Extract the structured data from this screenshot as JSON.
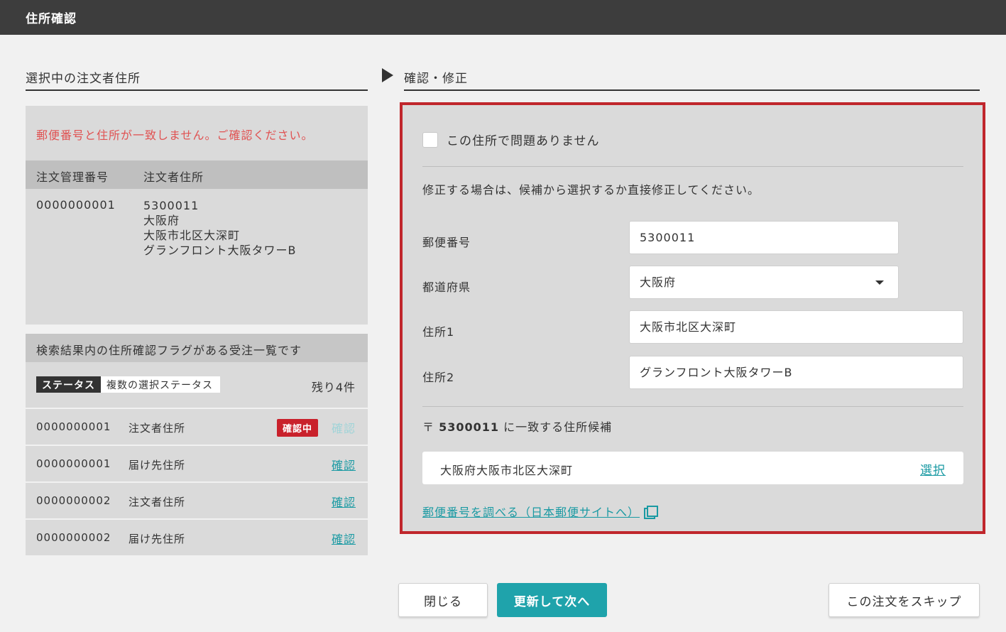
{
  "window": {
    "title": "住所確認"
  },
  "left": {
    "heading": "選択中の注文者住所",
    "alert": "郵便番号と住所が一致しません。ご確認ください。",
    "table": {
      "col_order_no": "注文管理番号",
      "col_address": "注文者住所",
      "order_no": "0000000001",
      "address_lines": [
        "5300011",
        "大阪府",
        "大阪市北区大深町",
        "グランフロント大阪タワーB"
      ]
    },
    "list": {
      "heading": "検索結果内の住所確認フラグがある受注一覧です",
      "status_label": "ステータス",
      "status_value": "複数の選択ステータス",
      "remaining": "残り4件",
      "rows": [
        {
          "order_no": "0000000001",
          "kind": "注文者住所",
          "badge": "確認中",
          "link": "確認"
        },
        {
          "order_no": "0000000001",
          "kind": "届け先住所",
          "link": "確認"
        },
        {
          "order_no": "0000000002",
          "kind": "注文者住所",
          "link": "確認"
        },
        {
          "order_no": "0000000002",
          "kind": "届け先住所",
          "link": "確認"
        }
      ]
    }
  },
  "right": {
    "heading": "確認・修正",
    "checkbox_label": "この住所で問題ありません",
    "hint": "修正する場合は、候補から選択するか直接修正してください。",
    "fields": {
      "postal_label": "郵便番号",
      "postal_value": "5300011",
      "pref_label": "都道府県",
      "pref_value": "大阪府",
      "addr1_label": "住所1",
      "addr1_value": "大阪市北区大深町",
      "addr2_label": "住所2",
      "addr2_value": "グランフロント大阪タワーB"
    },
    "candidates": {
      "prefix": "〒",
      "postal": "5300011",
      "suffix": "に一致する住所候補",
      "item": "大阪府大阪市北区大深町",
      "select_label": "選択"
    },
    "postal_link": "郵便番号を調べる（日本郵便サイトへ）"
  },
  "footer": {
    "close": "閉じる",
    "update_next": "更新して次へ",
    "skip": "この注文をスキップ"
  },
  "colors": {
    "accent": "#1fa3ab",
    "alert": "#e05252",
    "highlight_border": "#c0262c",
    "badge": "#c9212b"
  },
  "icons": {
    "external_link": "external-link-icon",
    "dropdown": "caret-down-icon"
  }
}
